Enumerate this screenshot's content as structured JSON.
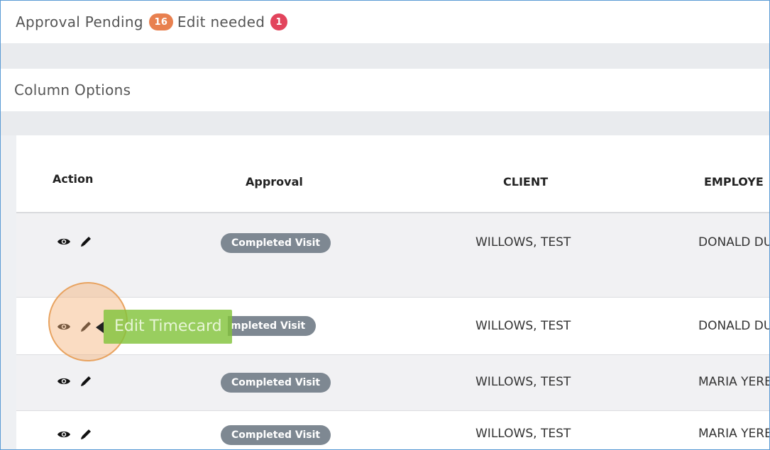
{
  "status": {
    "approval_pending_label": "Approval Pending",
    "approval_pending_count": "16",
    "edit_needed_label": "Edit needed",
    "edit_needed_count": "1"
  },
  "column_options_label": "Column Options",
  "table": {
    "headers": {
      "action": "Action",
      "approval": "Approval",
      "client": "CLIENT",
      "employee": "EMPLOYE"
    },
    "rows": [
      {
        "approval": "Completed Visit",
        "client": "WILLOWS, TEST",
        "employee": "DONALD DU"
      },
      {
        "approval": "mpleted Visit",
        "client": "WILLOWS, TEST",
        "employee": "DONALD DU"
      },
      {
        "approval": "Completed Visit",
        "client": "WILLOWS, TEST",
        "employee": "MARIA YERE"
      },
      {
        "approval": "Completed Visit",
        "client": "WILLOWS, TEST",
        "employee": "MARIA YERE"
      }
    ]
  },
  "tooltip": {
    "text": "Edit Timecard"
  },
  "icons": {
    "view": "eye-icon",
    "edit": "pencil-icon"
  },
  "colors": {
    "pending_badge": "#e8804f",
    "edit_badge": "#e2445c",
    "status_pill": "#7e8892",
    "tooltip": "#82c33c",
    "highlight": "#f5b278",
    "frame_border": "#5b9bd5"
  }
}
